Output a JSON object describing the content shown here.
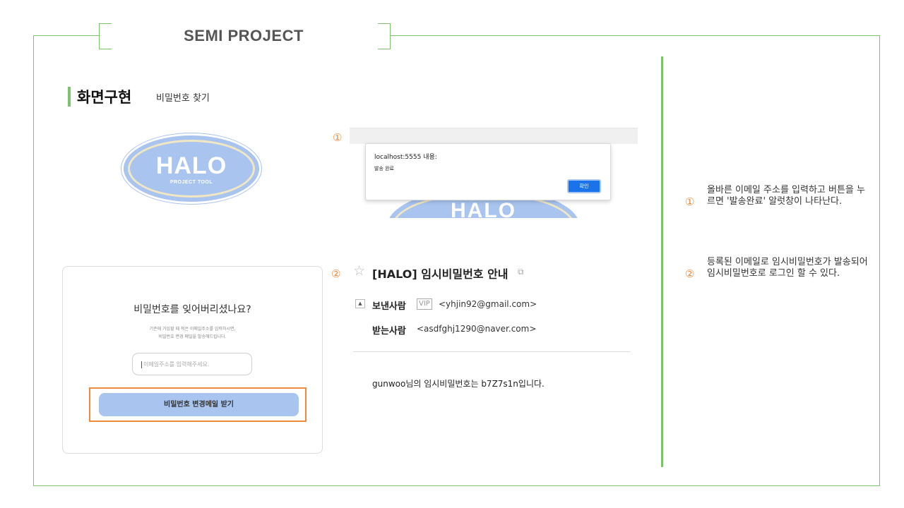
{
  "deck": {
    "title": "SEMI PROJECT"
  },
  "section": {
    "title": "화면구현",
    "subtitle": "비밀번호 찾기"
  },
  "logo": {
    "text": "HALO",
    "subtext": "PROJECT TOOL"
  },
  "forgot_card": {
    "title": "비밀번호를 잊어버리셨나요?",
    "description_line1": "기존에 가입할 때 적은 이메일주소를 입력하시면,",
    "description_line2": "비밀번호 변경 메일을 발송해드립니다.",
    "email_placeholder": "이메일주소를 입력해주세요.",
    "submit_label": "비밀번호 변경메일 받기"
  },
  "alert": {
    "host": "localhost:5555 내용:",
    "message": "발송 완료",
    "ok_label": "확인",
    "background_logo": "HALO"
  },
  "email": {
    "subject": "[HALO] 임시비밀번호 안내",
    "from_label": "보낸사람",
    "vip_badge": "VIP",
    "from_address": "<yhjin92@gmail.com>",
    "to_label": "받는사람",
    "to_address": "<asdfghj1290@naver.com>",
    "body": "gunwoo님의 임시비밀번호는 b7Z7s1n입니다."
  },
  "markers": {
    "one": "①",
    "two": "②"
  },
  "notes": [
    {
      "number": "①",
      "text": "올바른 이메일 주소를 입력하고 버튼을 누르면 '발송완료' 알럿창이 나타난다."
    },
    {
      "number": "②",
      "text": "등록된 이메일로 임시비밀번호가 발송되어 임시비밀번호로 로그인 할 수 있다."
    }
  ],
  "colors": {
    "accent_green": "#7cc36b",
    "accent_orange": "#ef8a3c",
    "halo_blue": "#a8c4ef",
    "alert_button": "#1a73e8"
  }
}
